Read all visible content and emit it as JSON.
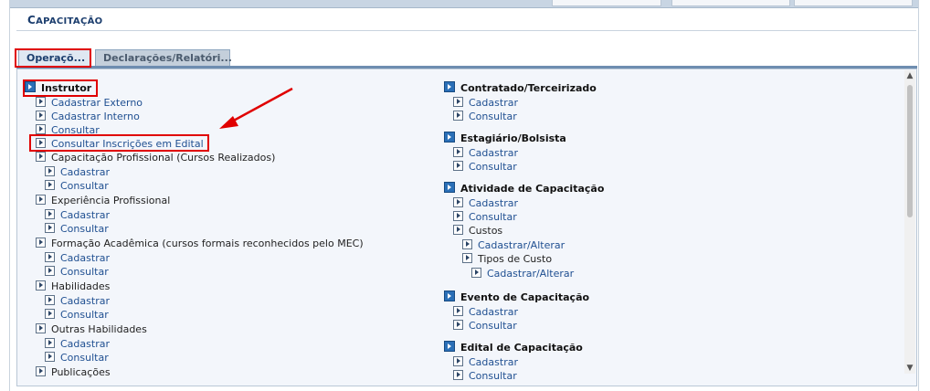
{
  "module": {
    "title_cap": "C",
    "title_rest": "apacitação"
  },
  "tabs": [
    {
      "label": "Operaçõ..."
    },
    {
      "label": "Declarações/Relatóri..."
    }
  ],
  "left_menu": {
    "section": "Instrutor",
    "items": [
      {
        "label": "Cadastrar Externo"
      },
      {
        "label": "Cadastrar Interno"
      },
      {
        "label": "Consultar"
      },
      {
        "label": "Consultar Inscrições em Edital"
      },
      {
        "label": "Capacitação Profissional (Cursos Realizados)",
        "children": [
          "Cadastrar",
          "Consultar"
        ]
      },
      {
        "label": "Experiência Profissional",
        "children": [
          "Cadastrar",
          "Consultar"
        ]
      },
      {
        "label": "Formação Acadêmica (cursos formais reconhecidos pelo MEC)",
        "children": [
          "Cadastrar",
          "Consultar"
        ]
      },
      {
        "label": "Habilidades",
        "children": [
          "Cadastrar",
          "Consultar"
        ]
      },
      {
        "label": "Outras Habilidades",
        "children": [
          "Cadastrar",
          "Consultar"
        ]
      },
      {
        "label": "Publicações"
      }
    ]
  },
  "right_menu": {
    "sections": [
      {
        "title": "Contratado/Terceirizado",
        "items": [
          "Cadastrar",
          "Consultar"
        ]
      },
      {
        "title": "Estagiário/Bolsista",
        "items": [
          "Cadastrar",
          "Consultar"
        ]
      },
      {
        "title": "Atividade de Capacitação",
        "items": [
          "Cadastrar",
          "Consultar"
        ],
        "custos": {
          "label": "Custos",
          "link": "Cadastrar/Alterar",
          "tipos": "Tipos de Custo",
          "tipos_link": "Cadastrar/Alterar"
        }
      },
      {
        "title": "Evento de Capacitação",
        "items": [
          "Cadastrar",
          "Consultar"
        ]
      },
      {
        "title": "Edital de Capacitação",
        "items": [
          "Cadastrar",
          "Consultar"
        ]
      }
    ]
  },
  "annotation_color": "#e00000"
}
